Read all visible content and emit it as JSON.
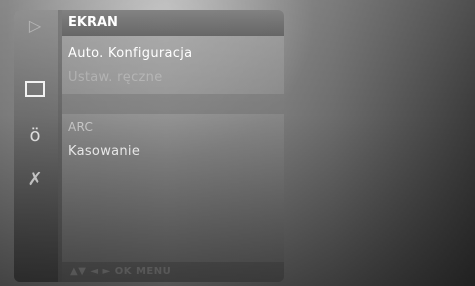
{
  "sidebar": {
    "icons": [
      {
        "name": "picture-icon"
      },
      {
        "name": "audio-speaker-icon"
      },
      {
        "name": "options-icon"
      }
    ]
  },
  "menu": {
    "title": "EKRAN",
    "items": [
      {
        "label": "Auto. Konfiguracja",
        "state": "normal"
      },
      {
        "label": "Ustaw. ręczne",
        "state": "disabled"
      },
      {
        "label": "ARC",
        "state": "dimmed"
      },
      {
        "label": "Kasowanie",
        "state": "selected"
      }
    ]
  },
  "hint_bar": {
    "text": "▲▼ ◄ ► OK  MENU"
  }
}
